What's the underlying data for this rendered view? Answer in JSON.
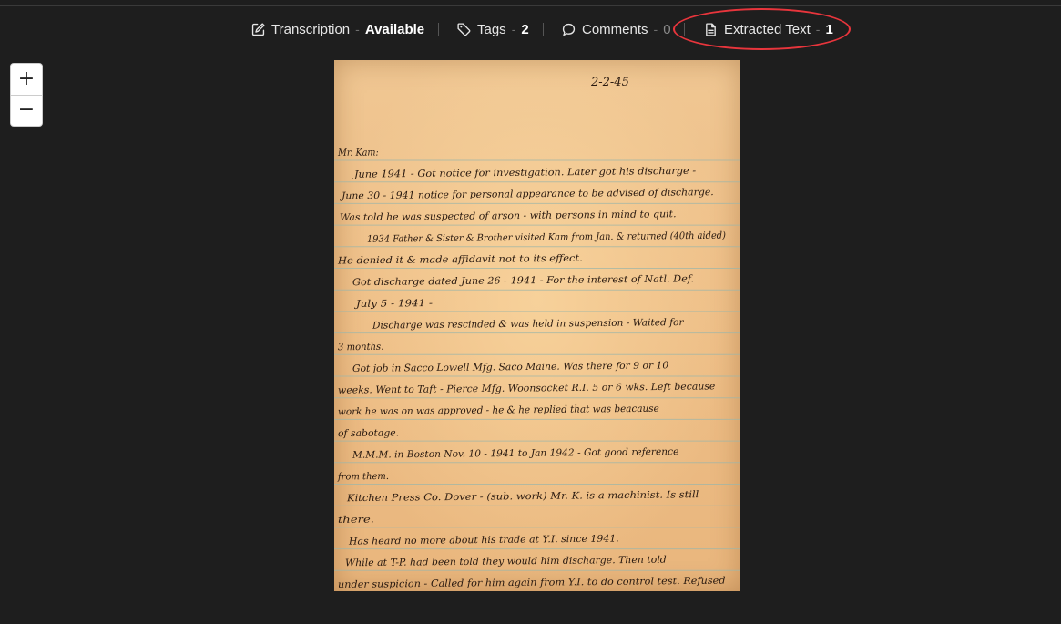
{
  "toolbar": {
    "transcription": {
      "label": "Transcription",
      "status": "Available"
    },
    "tags": {
      "label": "Tags",
      "count": "2"
    },
    "comments": {
      "label": "Comments",
      "count": "0"
    },
    "extracted_text": {
      "label": "Extracted Text",
      "count": "1"
    },
    "separator": "-"
  },
  "zoom": {
    "in_label": "+",
    "out_label": "−"
  },
  "colors": {
    "background": "#1e1e1e",
    "highlight": "#e8353c",
    "paper": "#eebf88",
    "ink": "#2a1a10",
    "rule_line": "#9fb6a8"
  },
  "document": {
    "date": "2-2-45",
    "lines": [
      "Mr. Kam:",
      "June 1941 - Got notice for investigation. Later got his discharge -",
      "June 30 - 1941 notice for personal appearance to be advised of discharge.",
      "Was told he was suspected of arson - with persons in mind to quit.",
      "1934 Father & Sister & Brother visited Kam from Jan. & returned (40th aided)",
      "He denied it & made affidavit not to its effect.",
      "Got discharge dated June 26 - 1941 - For the interest of Natl. Def.",
      "July 5 - 1941 -",
      "Discharge was rescinded & was held in suspension - Waited for",
      "3 months.",
      "Got job in Sacco Lowell Mfg. Saco Maine. Was there for 9 or 10",
      "weeks. Went to Taft - Pierce Mfg. Woonsocket R.I. 5 or 6 wks. Left because",
      "work he was on was approved - he & he replied that was beacause",
      "of sabotage.",
      "M.M.M. in Boston Nov. 10 - 1941 to Jan 1942 - Got good reference",
      "from them.",
      "Kitchen Press Co. Dover - (sub. work) Mr. K. is a machinist. Is still",
      "there.",
      "Has heard no more about his trade at Y.I. since 1941.",
      "While at T-P. had been told they would him discharge. Then told",
      "under suspicion - Called for him again from Y.I. to do control test. Refused"
    ]
  }
}
